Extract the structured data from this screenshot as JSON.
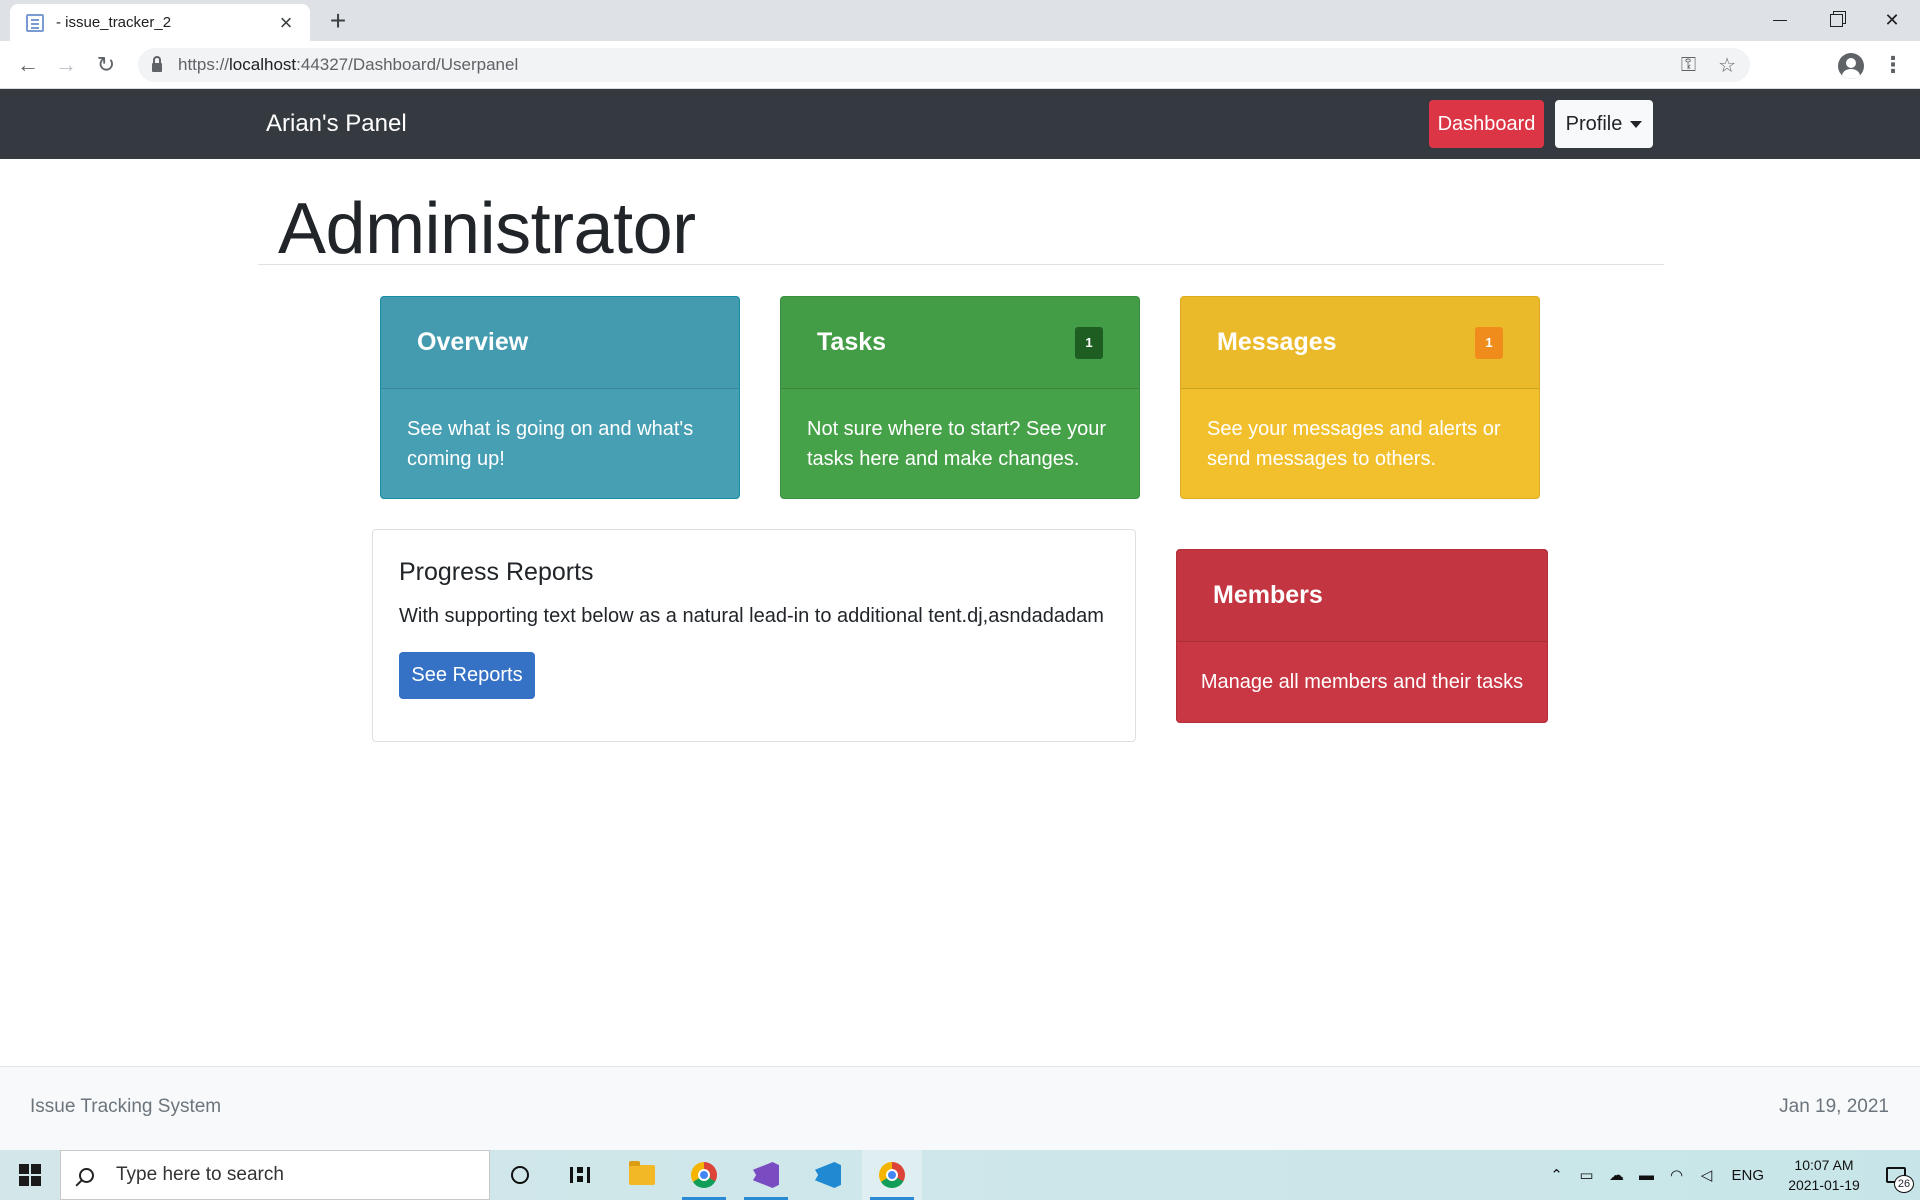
{
  "browser": {
    "tab_title": "- issue_tracker_2",
    "url_prefix": "https://",
    "url_host": "localhost",
    "url_rest": ":44327/Dashboard/Userpanel"
  },
  "navbar": {
    "brand": "Arian's Panel",
    "dashboard_label": "Dashboard",
    "profile_label": "Profile"
  },
  "page": {
    "heading": "Administrator"
  },
  "cards": {
    "overview": {
      "title": "Overview",
      "body": "See what is going on and what's coming up!",
      "color": "#479fb4"
    },
    "tasks": {
      "title": "Tasks",
      "badge": "1",
      "body": "Not sure where to start? See your tasks here and make changes.",
      "color": "#46a249"
    },
    "messages": {
      "title": "Messages",
      "badge": "1",
      "body": "See your messages and alerts or send messages to others.",
      "color": "#f3c02d"
    },
    "members": {
      "title": "Members",
      "body": "Manage all members and their tasks",
      "color": "#c93744"
    },
    "progress": {
      "title": "Progress Reports",
      "text": "With supporting text below as a natural lead-in to additional tent.dj,asndadadam",
      "button_label": "See Reports",
      "button_color": "#3572c6"
    }
  },
  "footer": {
    "left": "Issue Tracking System",
    "right": "Jan 19, 2021"
  },
  "taskbar": {
    "search_placeholder": "Type here to search",
    "lang": "ENG",
    "time": "10:07 AM",
    "date": "2021-01-19",
    "notification_count": "26",
    "pinned_apps": [
      "cortana-icon",
      "task-view-icon",
      "file-explorer-icon",
      "chrome-icon",
      "visual-studio-icon",
      "vscode-icon",
      "chrome-icon"
    ]
  }
}
